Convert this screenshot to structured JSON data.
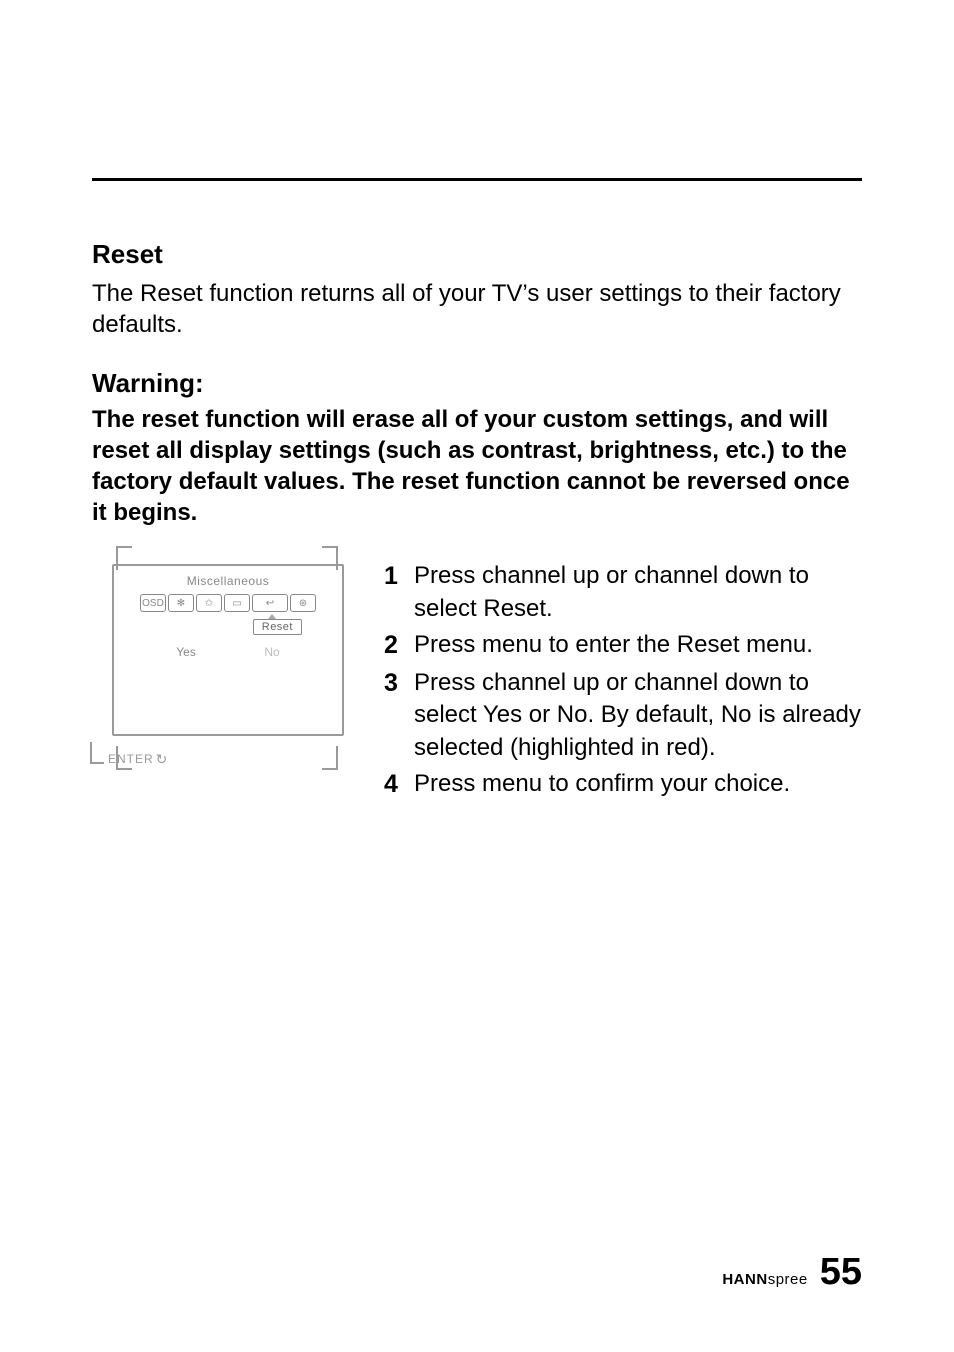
{
  "section": {
    "title": "Reset",
    "intro": "The Reset function returns all of your TV’s user settings to their factory defaults."
  },
  "warning": {
    "title": "Warning:",
    "body": "The reset function will erase all of your custom settings, and will reset all display settings (such as contrast, brightness, etc.) to the factory default values. The reset function cannot be reversed once it begins."
  },
  "osd": {
    "menu_title": "Miscellaneous",
    "submenu_label": "Reset",
    "option_yes": "Yes",
    "option_no": "No",
    "enter_label": "ENTER",
    "icons": [
      "osd-icon",
      "gear-icon",
      "star-icon",
      "tv-icon",
      "return-icon",
      "globe-icon"
    ]
  },
  "steps": [
    {
      "num": "1",
      "text": "Press channel up or channel down to select Reset."
    },
    {
      "num": "2",
      "text": "Press menu to enter the Reset menu."
    },
    {
      "num": "3",
      "text": "Press channel up or channel down to select Yes or No. By default, No is already selected (highlighted in red)."
    },
    {
      "num": "4",
      "text": "Press menu to confirm your choice."
    }
  ],
  "footer": {
    "brand_bold": "HANN",
    "brand_light": "spree",
    "page_number": "55"
  }
}
